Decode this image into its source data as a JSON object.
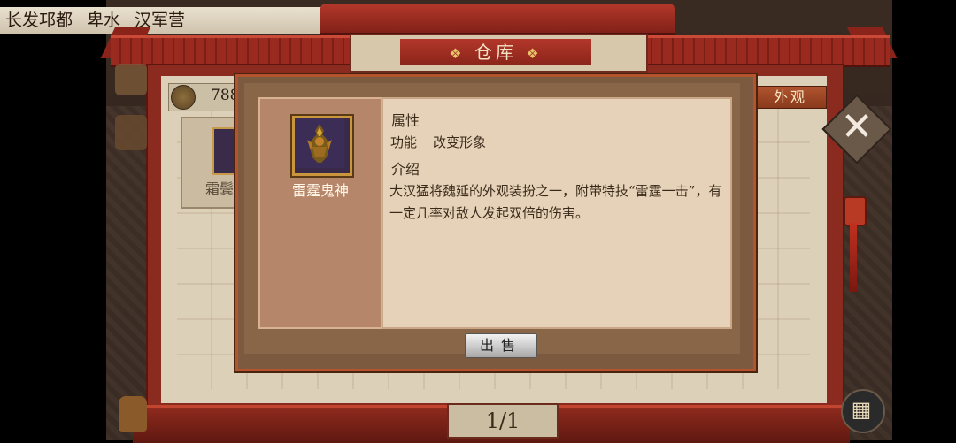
{
  "location": [
    "长发邛都",
    "卑水",
    "汉军营"
  ],
  "window": {
    "title": "仓库"
  },
  "currency": {
    "value": "788"
  },
  "tabs": {
    "appearance": "外观"
  },
  "grid_item": {
    "label": "霜鬓"
  },
  "pagination": {
    "label": "1/1"
  },
  "popup": {
    "item_name": "雷霆鬼神",
    "section_attributes": "属性",
    "attribute_key": "功能",
    "attribute_value": "改变形象",
    "section_intro": "介绍",
    "description": "大汉猛将魏延的外观装扮之一，附带特技“雷霆一击”，有一定几率对敌人发起双倍的伤害。",
    "sell_label": "出售"
  }
}
